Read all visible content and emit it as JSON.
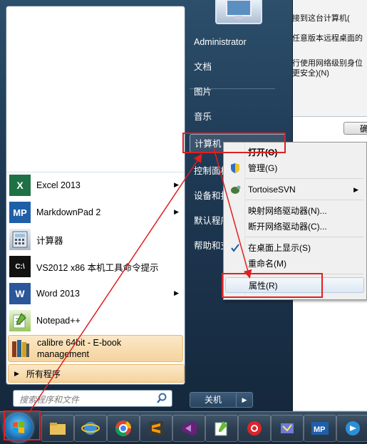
{
  "background_window": {
    "lines": [
      "接到这台计算机(",
      "任意版本远程桌面的",
      "行使用网络级别身位",
      "更安全)(N)"
    ],
    "ok_button": "确"
  },
  "start_menu": {
    "pinned": [
      {
        "label": "Excel 2013",
        "icon": "excel-icon",
        "has_submenu": true
      },
      {
        "label": "MarkdownPad 2",
        "icon": "markdownpad-icon",
        "has_submenu": true
      },
      {
        "label": "计算器",
        "icon": "calculator-icon",
        "has_submenu": false
      },
      {
        "label": "VS2012 x86 本机工具命令提示",
        "icon": "command-prompt-icon",
        "has_submenu": false
      },
      {
        "label": "Word 2013",
        "icon": "word-icon",
        "has_submenu": true
      },
      {
        "label": "Notepad++",
        "icon": "notepadpp-icon",
        "has_submenu": false
      },
      {
        "label": "calibre 64bit - E-book management",
        "icon": "calibre-icon",
        "has_submenu": false
      }
    ],
    "all_programs": "所有程序",
    "search_placeholder": "搜索程序和文件",
    "right_items": [
      "Administrator",
      "文档",
      "图片",
      "音乐",
      "计算机",
      "控制面板",
      "设备和打印机",
      "默认程序",
      "帮助和支持"
    ],
    "shutdown_label": "关机"
  },
  "context_menu": {
    "items": [
      {
        "label": "打开(O)",
        "bold": true,
        "icon": ""
      },
      {
        "label": "管理(G)",
        "bold": false,
        "icon": "shield-icon"
      },
      {
        "label": "TortoiseSVN",
        "bold": false,
        "icon": "tortoisesvn-icon",
        "submenu": true
      },
      {
        "label": "映射网络驱动器(N)...",
        "bold": false,
        "icon": ""
      },
      {
        "label": "断开网络驱动器(C)...",
        "bold": false,
        "icon": ""
      },
      {
        "label": "在桌面上显示(S)",
        "bold": false,
        "icon": "checkmark-icon"
      },
      {
        "label": "重命名(M)",
        "bold": false,
        "icon": ""
      },
      {
        "label": "属性(R)",
        "bold": false,
        "icon": ""
      }
    ]
  },
  "taskbar": {
    "buttons": [
      "explorer-icon",
      "ie-icon",
      "chrome-icon",
      "sublime-icon",
      "visualstudio-icon",
      "notepadpp-icon",
      "netease-music-icon",
      "putty-icon",
      "markdownpad-icon",
      "app-icon"
    ]
  },
  "colors": {
    "annotation_red": "#e02020",
    "highlight": "#f5d39d"
  }
}
